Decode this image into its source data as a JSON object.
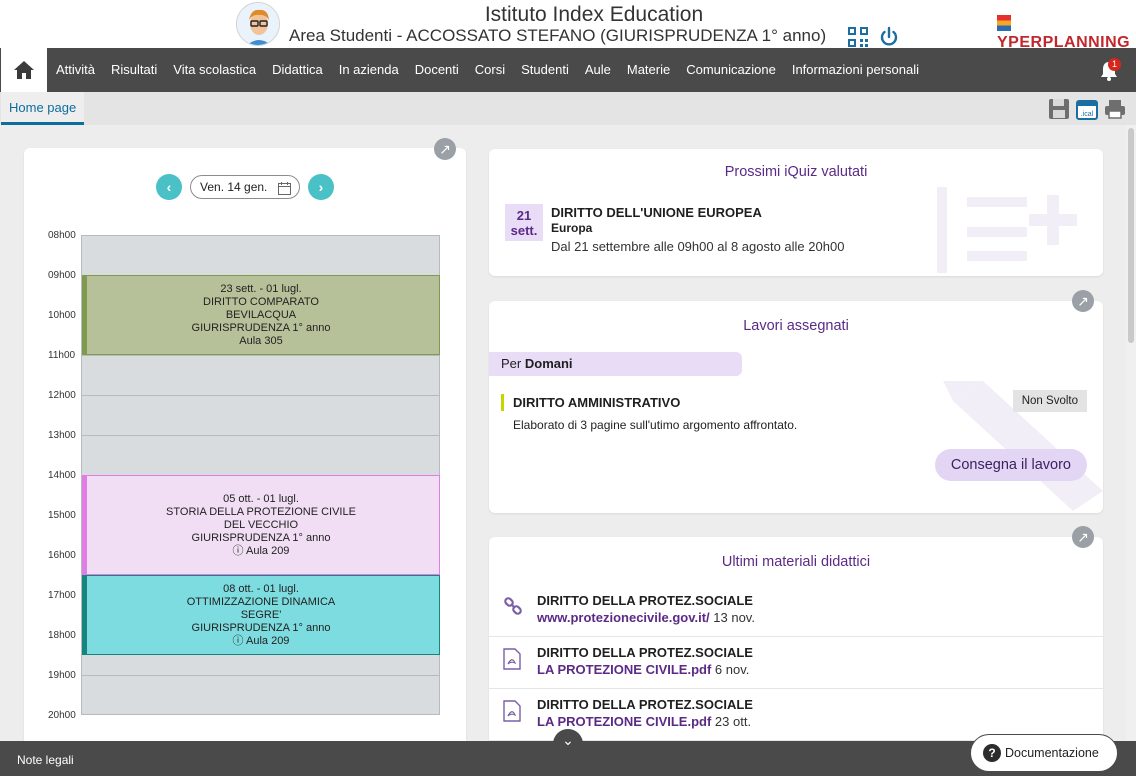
{
  "header": {
    "school": "Istituto Index Education",
    "user_line": "Area Studenti - ACCOSSATO STEFANO (GIURISPRUDENZA  1° anno)",
    "brand": "YPERPLANNING"
  },
  "nav": {
    "items": [
      "Attività",
      "Risultati",
      "Vita scolastica",
      "Didattica",
      "In azienda",
      "Docenti",
      "Corsi",
      "Studenti",
      "Aule",
      "Materie",
      "Comunicazione",
      "Informazioni personali"
    ],
    "notifications": "1"
  },
  "subtab": {
    "label": "Home page"
  },
  "timetable": {
    "date": "Ven. 14 gen.",
    "hours": [
      "08h00",
      "09h00",
      "10h00",
      "11h00",
      "12h00",
      "13h00",
      "14h00",
      "15h00",
      "16h00",
      "17h00",
      "18h00",
      "19h00",
      "20h00"
    ],
    "lessons": [
      {
        "period": "23 sett. - 01 lugl.",
        "subject": "DIRITTO COMPARATO",
        "teacher": "BEVILACQUA",
        "course": "GIURISPRUDENZA  1° anno",
        "room": "Aula 305",
        "color": "#b6c199",
        "border": "#7f9a4e",
        "start": 1,
        "end": 3
      },
      {
        "period": "05 ott. - 01 lugl.",
        "subject": "STORIA DELLA PROTEZIONE CIVILE",
        "teacher": "DEL VECCHIO",
        "course": "GIURISPRUDENZA  1° anno",
        "room": "Aula 209",
        "color": "#f1def4",
        "border": "#e17ee6",
        "start": 6,
        "end": 8.5
      },
      {
        "period": "08 ott. - 01 lugl.",
        "subject": "OTTIMIZZAZIONE DINAMICA",
        "teacher": "SEGRE'",
        "course": "GIURISPRUDENZA  1° anno",
        "room": "Aula 209",
        "color": "#7ddcdf",
        "border": "#17857f",
        "start": 8.5,
        "end": 10.5
      }
    ]
  },
  "quiz": {
    "title": "Prossimi iQuiz valutati",
    "badge_day": "21",
    "badge_month": "sett.",
    "subject": "DIRITTO DELL'UNIONE EUROPEA",
    "name": "Europa",
    "period": "Dal 21 settembre alle 09h00 al 8 agosto alle 20h00"
  },
  "works": {
    "title": "Lavori assegnati",
    "per_label": "Per",
    "per_value": "Domani",
    "subject": "DIRITTO AMMINISTRATIVO",
    "status": "Non Svolto",
    "description": "Elaborato di 3 pagine sull'utimo argomento affrontato.",
    "button": "Consegna il lavoro"
  },
  "materials": {
    "title": "Ultimi materiali didattici",
    "items": [
      {
        "subject": "DIRITTO DELLA PROTEZ.SOCIALE",
        "link": "www.protezionecivile.gov.it/",
        "date": "13 nov.",
        "icon": "link-icon"
      },
      {
        "subject": "DIRITTO DELLA PROTEZ.SOCIALE",
        "link": "LA PROTEZIONE CIVILE.pdf",
        "date": "6 nov.",
        "icon": "pdf-icon"
      },
      {
        "subject": "DIRITTO DELLA PROTEZ.SOCIALE",
        "link": "LA PROTEZIONE CIVILE.pdf",
        "date": "23 ott.",
        "icon": "pdf-icon"
      }
    ]
  },
  "footer": {
    "legal": "Note legali",
    "docs": "Documentazione"
  }
}
